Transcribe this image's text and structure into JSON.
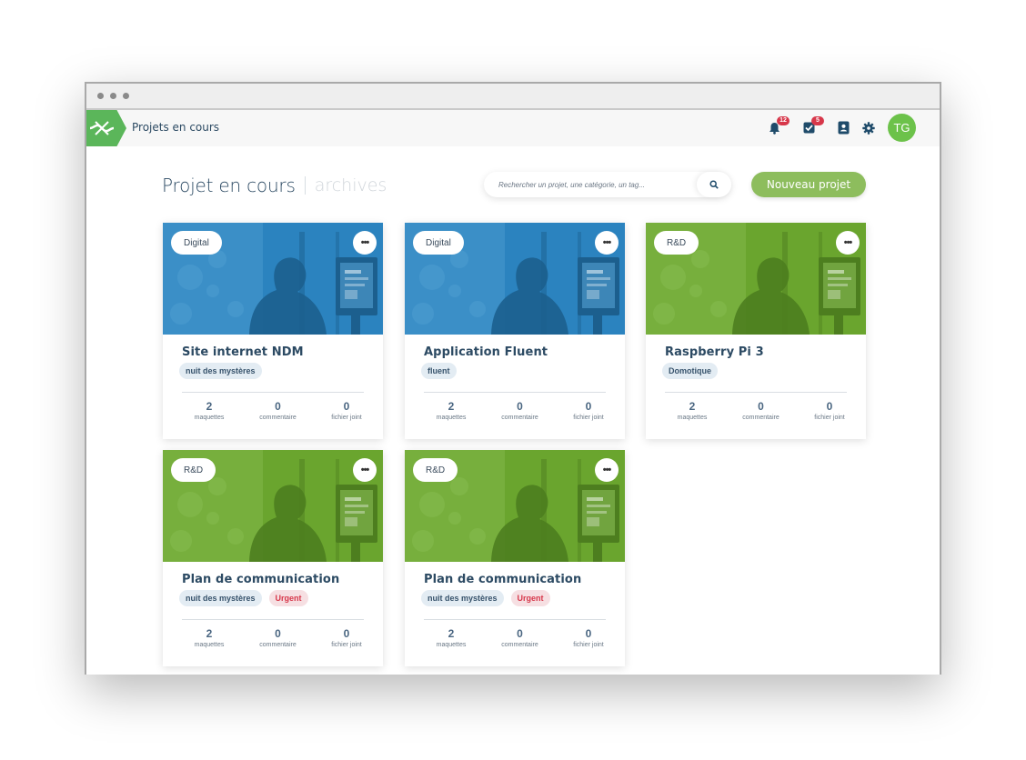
{
  "appbar": {
    "title": "Projets en cours",
    "notifications_count": "12",
    "tasks_count": "5",
    "avatar_initials": "TG"
  },
  "header": {
    "title": "Projet en cours",
    "archives_label": "archives",
    "search_placeholder": "Rechercher un projet, une catégorie, un tag...",
    "new_project_label": "Nouveau projet"
  },
  "colors": {
    "accent": "#8dbd5d",
    "digital_tint": "#2b83bf",
    "rnd_tint": "#6aa52e",
    "urgent": "#d7374a"
  },
  "projects": [
    {
      "category": "Digital",
      "title": "Site internet NDM",
      "tags": [
        {
          "label": "nuit des mystères",
          "style": "blue"
        }
      ],
      "stats": [
        {
          "value": "2",
          "label": "maquettes"
        },
        {
          "value": "0",
          "label": "commentaire"
        },
        {
          "value": "0",
          "label": "fichier joint"
        }
      ]
    },
    {
      "category": "Digital",
      "title": "Application Fluent",
      "tags": [
        {
          "label": "fluent",
          "style": "blue"
        }
      ],
      "stats": [
        {
          "value": "2",
          "label": "maquettes"
        },
        {
          "value": "0",
          "label": "commentaire"
        },
        {
          "value": "0",
          "label": "fichier joint"
        }
      ]
    },
    {
      "category": "R&D",
      "title": "Raspberry Pi 3",
      "tags": [
        {
          "label": "Domotique",
          "style": "blue"
        }
      ],
      "stats": [
        {
          "value": "2",
          "label": "maquettes"
        },
        {
          "value": "0",
          "label": "commentaire"
        },
        {
          "value": "0",
          "label": "fichier joint"
        }
      ]
    },
    {
      "category": "R&D",
      "title": "Plan de communication",
      "tags": [
        {
          "label": "nuit des mystères",
          "style": "blue"
        },
        {
          "label": "Urgent",
          "style": "red"
        }
      ],
      "stats": [
        {
          "value": "2",
          "label": "maquettes"
        },
        {
          "value": "0",
          "label": "commentaire"
        },
        {
          "value": "0",
          "label": "fichier joint"
        }
      ]
    },
    {
      "category": "R&D",
      "title": "Plan de communication",
      "tags": [
        {
          "label": "nuit des mystères",
          "style": "blue"
        },
        {
          "label": "Urgent",
          "style": "red"
        }
      ],
      "stats": [
        {
          "value": "2",
          "label": "maquettes"
        },
        {
          "value": "0",
          "label": "commentaire"
        },
        {
          "value": "0",
          "label": "fichier joint"
        }
      ]
    }
  ]
}
